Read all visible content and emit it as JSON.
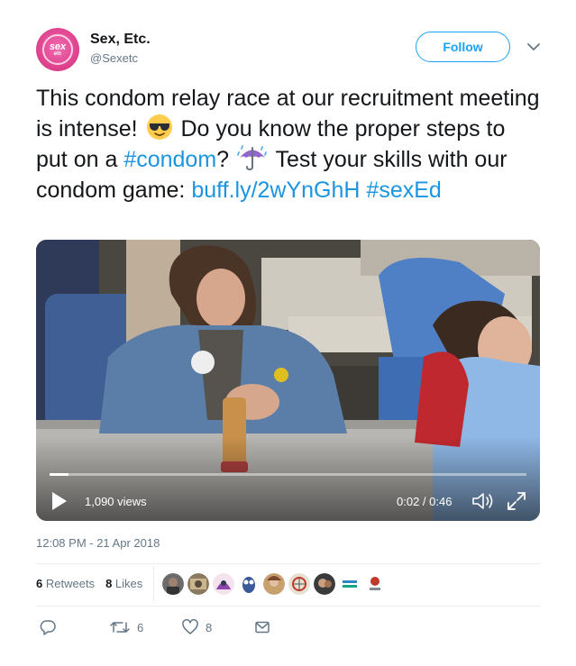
{
  "header": {
    "display_name": "Sex, Etc.",
    "handle": "@Sexetc",
    "avatar_text_line1": "sex",
    "avatar_text_line2": "etc",
    "follow_label": "Follow"
  },
  "tweet": {
    "text_part1": "This condom relay race at our recruitment meeting is intense!",
    "emoji_1": "smiling-face-with-sunglasses",
    "text_part2": "Do you know the proper steps to put on a",
    "hashtag_condom": "#condom",
    "text_part3": "?",
    "emoji_2": "umbrella-with-rain-drops",
    "text_part4": "Test your skills with our condom game:",
    "link": "buff.ly/2wYnGhH",
    "hashtag_sexed": "#sexEd"
  },
  "video": {
    "views": "1,090 views",
    "timecode": "0:02 / 0:46",
    "progress": 0.04,
    "play_icon": "play-icon",
    "volume_icon": "volume-icon",
    "fullscreen_icon": "fullscreen-icon"
  },
  "meta": {
    "timestamp": "12:08 PM - 21 Apr 2018"
  },
  "stats": {
    "retweets_count": "6",
    "retweets_label": "Retweets",
    "likes_count": "8",
    "likes_label": "Likes"
  },
  "actions": {
    "reply_icon": "reply-icon",
    "retweet_icon": "retweet-icon",
    "retweet_count": "6",
    "like_icon": "heart-icon",
    "like_count": "8",
    "message_icon": "envelope-icon"
  },
  "colors": {
    "accent": "#1da1f2",
    "link": "#1b95e0",
    "secondary_text": "#657786",
    "primary_text": "#14171a",
    "brand_pink": "#e0458f"
  }
}
